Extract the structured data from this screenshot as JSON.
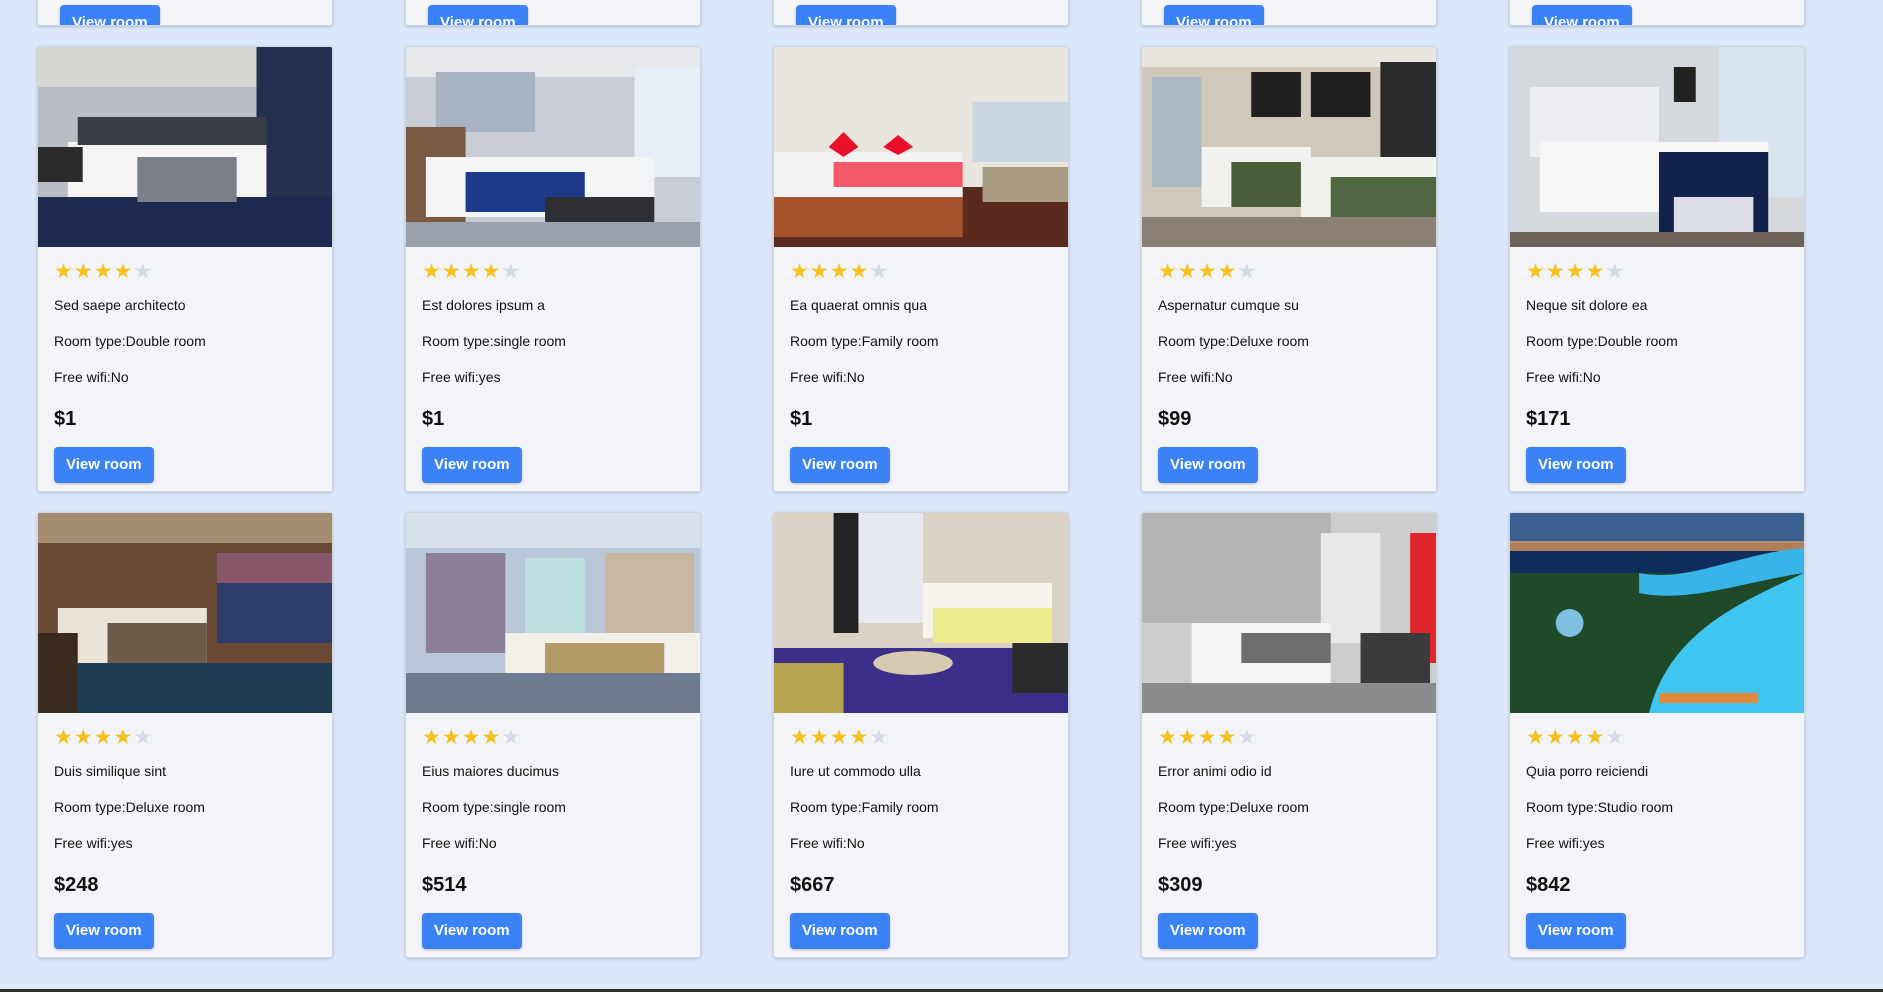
{
  "button_label": "View room",
  "rating_max": 5,
  "labels": {
    "room_type_prefix": "Room type:",
    "wifi_prefix": "Free wifi:"
  },
  "colors": {
    "accent": "#3b82f6",
    "star": "#f6c021",
    "star_off": "#d6dbe1",
    "background": "#dbe8fc"
  },
  "rooms": [
    {
      "title": "Sed saepe architecto",
      "room_type": "Room type:Double room",
      "wifi": "Free wifi:No",
      "price": "$1",
      "rating": 4,
      "image": "hotel-bed-blue-carpet"
    },
    {
      "title": "Est dolores ipsum a",
      "room_type": "Room type:single room",
      "wifi": "Free wifi:yes",
      "price": "$1",
      "rating": 4,
      "image": "hotel-bed-navy-blanket"
    },
    {
      "title": "Ea quaerat omnis qua",
      "room_type": "Room type:Family room",
      "wifi": "Free wifi:No",
      "price": "$1",
      "rating": 4,
      "image": "hotel-bed-red-pillows"
    },
    {
      "title": "Aspernatur cumque su",
      "room_type": "Room type:Deluxe room",
      "wifi": "Free wifi:No",
      "price": "$99",
      "rating": 4,
      "image": "hotel-twin-beds-green"
    },
    {
      "title": "Neque sit dolore ea",
      "room_type": "Room type:Double room",
      "wifi": "Free wifi:No",
      "price": "$171",
      "rating": 4,
      "image": "hotel-bed-city-view"
    },
    {
      "title": "Duis similique sint",
      "room_type": "Room type:Deluxe room",
      "wifi": "Free wifi:yes",
      "price": "$248",
      "rating": 4,
      "image": "hotel-bed-night-view"
    },
    {
      "title": "Eius maiores ducimus",
      "room_type": "Room type:single room",
      "wifi": "Free wifi:No",
      "price": "$514",
      "rating": 4,
      "image": "hotel-room-balcony"
    },
    {
      "title": "Iure ut commodo ulla",
      "room_type": "Room type:Family room",
      "wifi": "Free wifi:No",
      "price": "$667",
      "rating": 4,
      "image": "hotel-room-purple-carpet"
    },
    {
      "title": "Error animi odio id",
      "room_type": "Room type:Deluxe room",
      "wifi": "Free wifi:yes",
      "price": "$309",
      "rating": 4,
      "image": "hotel-room-red-wall"
    },
    {
      "title": "Quia porro reiciendi",
      "room_type": "Room type:Studio room",
      "wifi": "Free wifi:yes",
      "price": "$842",
      "rating": 4,
      "image": "resort-pool-night"
    }
  ]
}
